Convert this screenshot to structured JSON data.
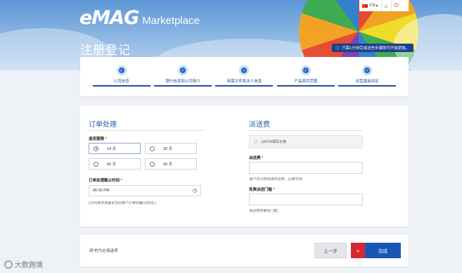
{
  "header": {
    "logo_brand": "eMAG",
    "logo_suffix": "Marketplace",
    "page_title": "注册登记",
    "hint": "只需1分钟完成这些步骤即可开始销售。",
    "language": "CN"
  },
  "steps": [
    {
      "label": "公司信息",
      "status": "completed"
    },
    {
      "label": "银行信息和公司简介",
      "status": "completed"
    },
    {
      "label": "商需文件和法人信息",
      "status": "completed"
    },
    {
      "label": "产品类目范围",
      "status": "completed"
    },
    {
      "label": "运营基础设定",
      "status": "active"
    }
  ],
  "order_processing": {
    "title": "订单处理",
    "return_period_label": "退货期限",
    "return_options": [
      "14 天",
      "30 天",
      "60 天",
      "90 天"
    ],
    "return_selected": "14 天",
    "cutoff_label": "订单处理截止时间",
    "cutoff_value": "06:00 PM",
    "cutoff_help": " (只代表您准备妥当对客户订单的截止时间。)"
  },
  "shipping": {
    "title": "派送费",
    "currency_note": "以RON填写价格",
    "fee_label": "派送费",
    "fee_value": "",
    "fee_help": "客户支付您快递的运费，以便交货。",
    "free_threshold_label": "免费派送门槛",
    "free_threshold_value": "",
    "free_threshold_help": "免运费的最低门槛。"
  },
  "footer": {
    "required_note": "用*的为必填选项",
    "prev_label": "上一步",
    "finish_label": "完成"
  },
  "colors": {
    "accent_blue": "#1a56b8",
    "accent_red": "#d8272e",
    "title_blue": "#2c5ea8"
  },
  "icons": [
    "info-icon",
    "home-icon",
    "power-icon",
    "clock-icon",
    "check-icon",
    "double-chevron-right-icon",
    "flag-cn-icon"
  ]
}
